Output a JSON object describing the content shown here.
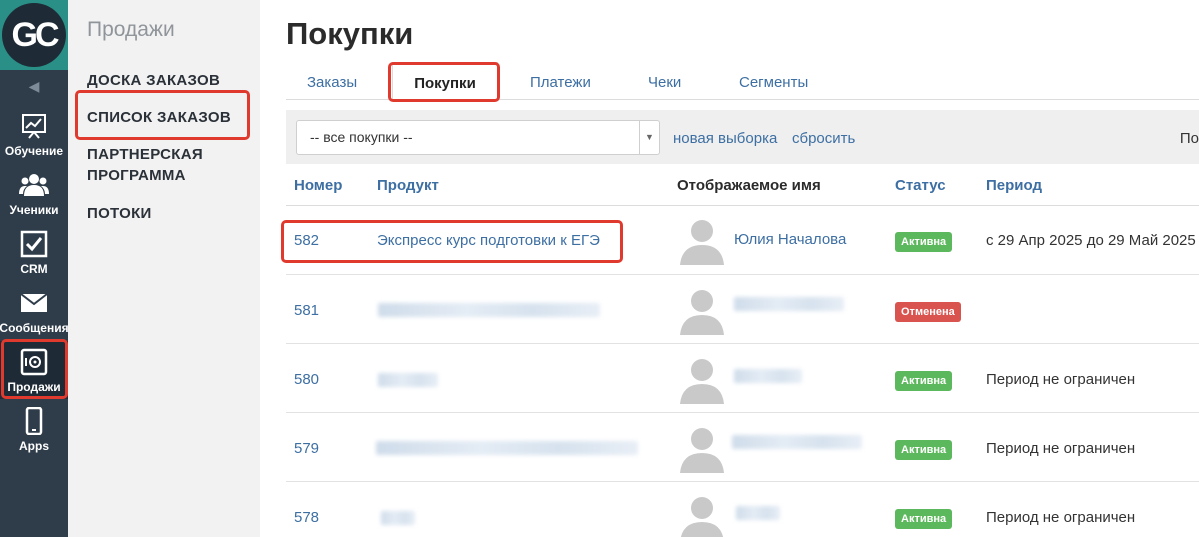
{
  "left_nav": {
    "logo_text": "GC",
    "items": [
      {
        "label": "Обучение",
        "icon": "chart-board-icon"
      },
      {
        "label": "Ученики",
        "icon": "users-icon"
      },
      {
        "label": "CRM",
        "icon": "checkbox-icon"
      },
      {
        "label": "Сообщения",
        "icon": "envelope-icon"
      },
      {
        "label": "Продажи",
        "icon": "safe-icon"
      },
      {
        "label": "Apps",
        "icon": "phone-icon"
      }
    ]
  },
  "submenu": {
    "title": "Продажи",
    "items": [
      {
        "label": "ДОСКА ЗАКАЗОВ"
      },
      {
        "label": "СПИСОК ЗАКАЗОВ"
      },
      {
        "label": "ПАРТНЕРСКАЯ ПРОГРАММА"
      },
      {
        "label": "ПОТОКИ"
      }
    ]
  },
  "main": {
    "title": "Покупки",
    "tabs": [
      {
        "label": "Заказы"
      },
      {
        "label": "Покупки",
        "active": true
      },
      {
        "label": "Платежи"
      },
      {
        "label": "Чеки"
      },
      {
        "label": "Сегменты"
      }
    ],
    "filter": {
      "select_value": "-- все покупки --",
      "new_selection": "новая выборка",
      "reset": "сбросить",
      "cutoff_text": "По"
    },
    "table": {
      "headers": {
        "number": "Номер",
        "product": "Продукт",
        "display_name": "Отображаемое имя",
        "status": "Статус",
        "period": "Период"
      },
      "rows": [
        {
          "number": "582",
          "product": "Экспресс курс подготовки к ЕГЭ",
          "name": "Юлия Началова",
          "status": "Активна",
          "status_color": "#5cb85c",
          "period": "с 29 Апр 2025 до 29 Май 2025"
        },
        {
          "number": "581",
          "status": "Отменена",
          "status_color": "#d9534f",
          "period": ""
        },
        {
          "number": "580",
          "status": "Активна",
          "status_color": "#5cb85c",
          "period": "Период не ограничен"
        },
        {
          "number": "579",
          "status": "Активна",
          "status_color": "#5cb85c",
          "period": "Период не ограничен"
        },
        {
          "number": "578",
          "status": "Активна",
          "status_color": "#5cb85c",
          "period": "Период не ограничен"
        }
      ]
    }
  },
  "colors": {
    "accent_link": "#3d6fa3",
    "nav_bg": "#2f3d4b",
    "highlight": "#e03a2f"
  }
}
